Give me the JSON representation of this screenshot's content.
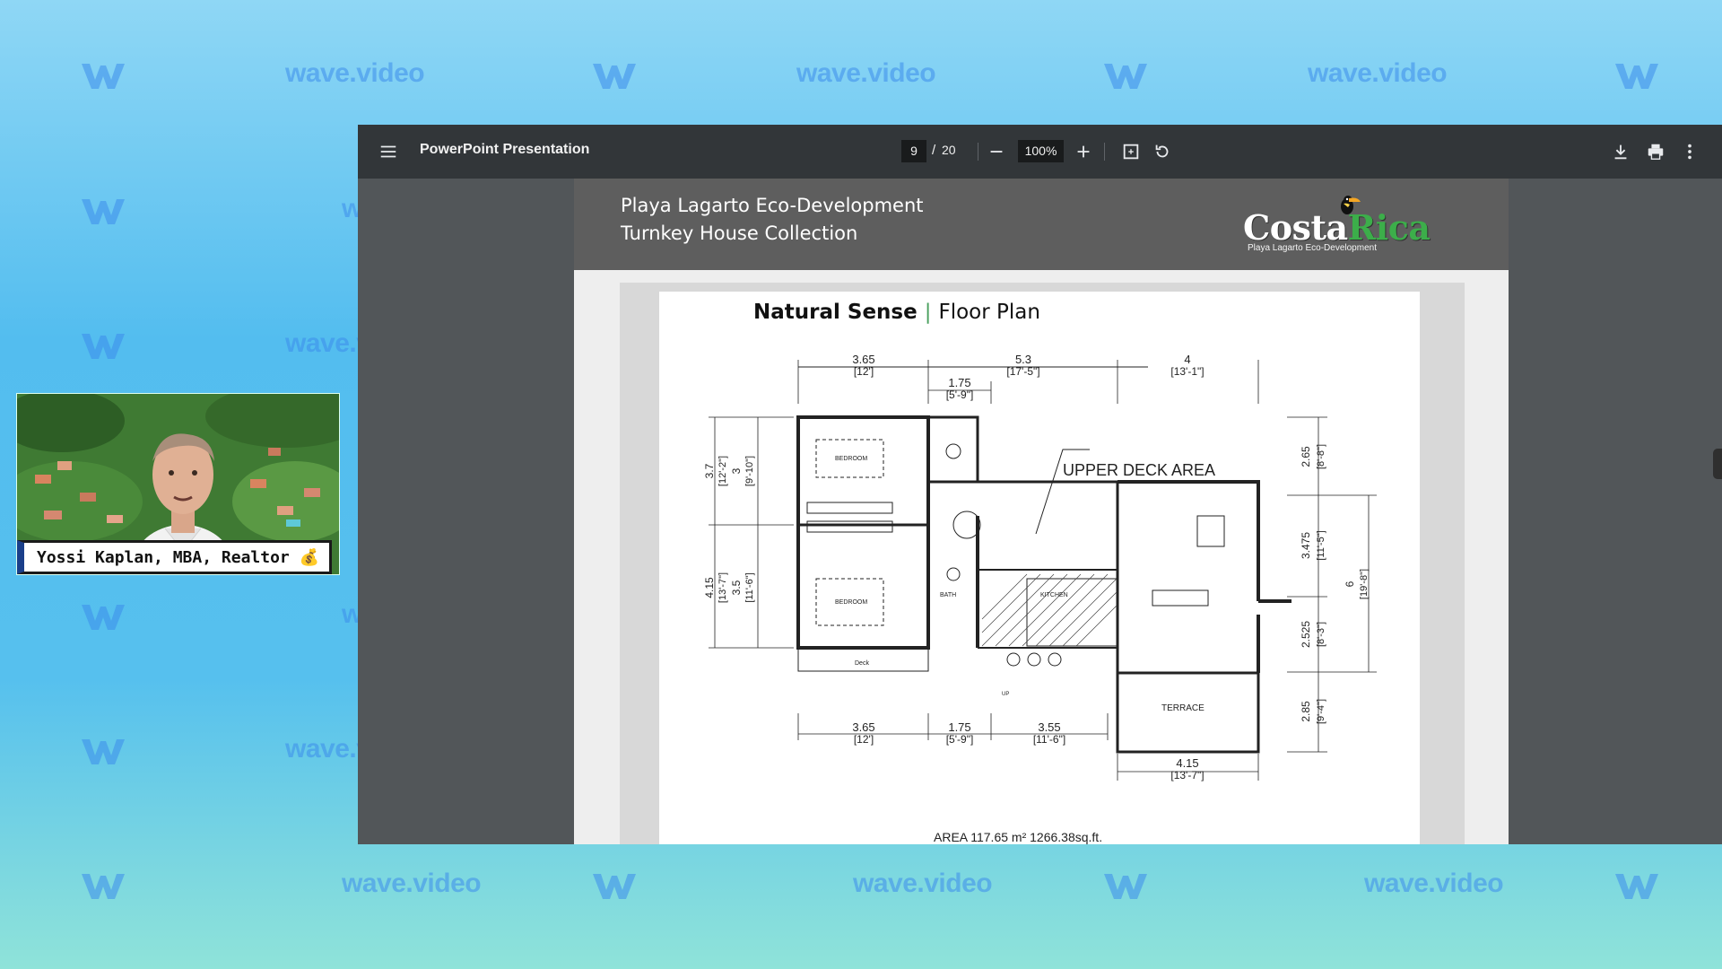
{
  "background": {
    "watermark_text": "wave.video",
    "watermark_logo_icon": "wave-w-icon",
    "colors": {
      "top": "#8fd7f5",
      "middle": "#53bdef",
      "bottom": "#8fe3d9",
      "watermark": "#3c8ceb"
    }
  },
  "viewer": {
    "title": "PowerPoint Presentation",
    "page_current": "9",
    "page_separator": "/",
    "page_total": "20",
    "zoom": "100%",
    "icons": {
      "menu": "menu-icon",
      "zoom_out": "minus-icon",
      "zoom_in": "plus-icon",
      "fit": "fit-page-icon",
      "rotate": "rotate-icon",
      "download": "download-icon",
      "print": "print-icon",
      "more": "more-vert-icon"
    },
    "colors": {
      "toolbar": "#323639",
      "canvas": "#525659"
    }
  },
  "slide": {
    "title_line1": "Playa Lagarto Eco-Development",
    "title_line2": "Turnkey House Collection",
    "logo_main": "Costa Rica",
    "logo_sub": "Playa Lagarto Eco-Development",
    "plan_name": "Natural Sense",
    "plan_separator": "|",
    "plan_type": "Floor Plan",
    "plan_labels": {
      "upper_deck": "UPPER DECK AREA",
      "bedroom_1": "BEDROOM",
      "bedroom_2": "BEDROOM",
      "bath": "BATH",
      "kitchen": "KITCHEN",
      "terrace": "TERRACE",
      "deck": "Deck",
      "up": "UP",
      "area": "AREA  117.65 m²    1266.38sq.ft."
    },
    "dimensions_top": [
      {
        "m": "3.65",
        "ft": "[12']"
      },
      {
        "m": "5.3",
        "ft": "[17'-5\"]"
      },
      {
        "m": "4",
        "ft": "[13'-1\"]"
      },
      {
        "m": "1.75",
        "ft": "[5'-9\"]"
      }
    ],
    "dimensions_bottom": [
      {
        "m": "3.65",
        "ft": "[12']"
      },
      {
        "m": "1.75",
        "ft": "[5'-9\"]"
      },
      {
        "m": "3.55",
        "ft": "[11'-6\"]"
      },
      {
        "m": "4.15",
        "ft": "[13'-7\"]"
      }
    ],
    "dimensions_left": [
      {
        "m": "3.7",
        "ft": "[12'-2\"]"
      },
      {
        "m": "3",
        "ft": "[9'-10\"]"
      },
      {
        "m": "4.15",
        "ft": "[13'-7\"]"
      },
      {
        "m": "3.5",
        "ft": "[11'-6\"]"
      }
    ],
    "dimensions_right": [
      {
        "m": "2.65",
        "ft": "[8'-8\"]"
      },
      {
        "m": "3.475",
        "ft": "[11'-5\"]"
      },
      {
        "m": "2.525",
        "ft": "[8'-3\"]"
      },
      {
        "m": "2.85",
        "ft": "[9'-4\"]"
      },
      {
        "m": "6",
        "ft": "[19'-8\"]"
      }
    ]
  },
  "presenter": {
    "name": "Yossi Kaplan, MBA, Realtor 💰"
  }
}
